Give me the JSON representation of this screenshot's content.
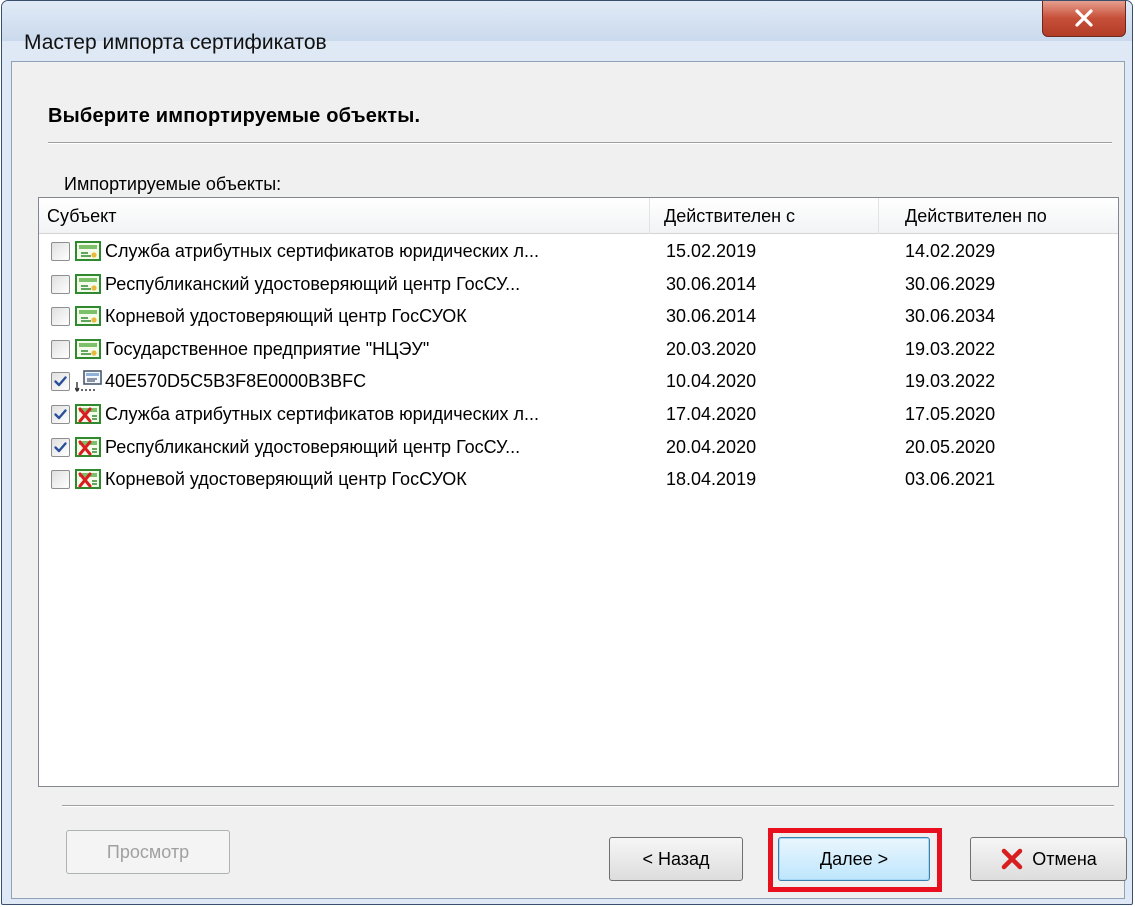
{
  "window": {
    "title": "Мастер импорта сертификатов"
  },
  "page": {
    "heading": "Выберите импортируемые объекты.",
    "list_label": "Импортируемые объекты:"
  },
  "columns": {
    "subject": "Субъект",
    "valid_from": "Действителен с",
    "valid_to": "Действителен по"
  },
  "rows": [
    {
      "subject": "Служба атрибутных сертификатов юридических л...",
      "valid_from": "15.02.2019",
      "valid_to": "14.02.2029",
      "checked": false,
      "icon": "certificate-icon"
    },
    {
      "subject": "Республиканский удостоверяющий центр ГосСУ...",
      "valid_from": "30.06.2014",
      "valid_to": "30.06.2029",
      "checked": false,
      "icon": "certificate-icon"
    },
    {
      "subject": "Корневой удостоверяющий центр ГосСУОК",
      "valid_from": "30.06.2014",
      "valid_to": "30.06.2034",
      "checked": false,
      "icon": "certificate-icon"
    },
    {
      "subject": "Государственное предприятие \"НЦЭУ\"",
      "valid_from": "20.03.2020",
      "valid_to": "19.03.2022",
      "checked": false,
      "icon": "certificate-icon"
    },
    {
      "subject": "40E570D5C5B3F8E0000B3BFC",
      "valid_from": "10.04.2020",
      "valid_to": "19.03.2022",
      "checked": true,
      "icon": "attribute-certificate-icon"
    },
    {
      "subject": "Служба атрибутных сертификатов юридических л...",
      "valid_from": "17.04.2020",
      "valid_to": "17.05.2020",
      "checked": true,
      "icon": "crl-icon"
    },
    {
      "subject": "Республиканский удостоверяющий центр ГосСУ...",
      "valid_from": "20.04.2020",
      "valid_to": "20.05.2020",
      "checked": true,
      "icon": "crl-icon"
    },
    {
      "subject": "Корневой удостоверяющий центр ГосСУОК",
      "valid_from": "18.04.2019",
      "valid_to": "03.06.2021",
      "checked": false,
      "icon": "crl-icon"
    }
  ],
  "buttons": {
    "preview": "Просмотр",
    "back": "< Назад",
    "next": "Далее >",
    "cancel": "Отмена"
  },
  "colors": {
    "highlight": "#e8101e",
    "cancel_icon": "#d81e1e",
    "cert_icon": "#2f8a2f"
  }
}
